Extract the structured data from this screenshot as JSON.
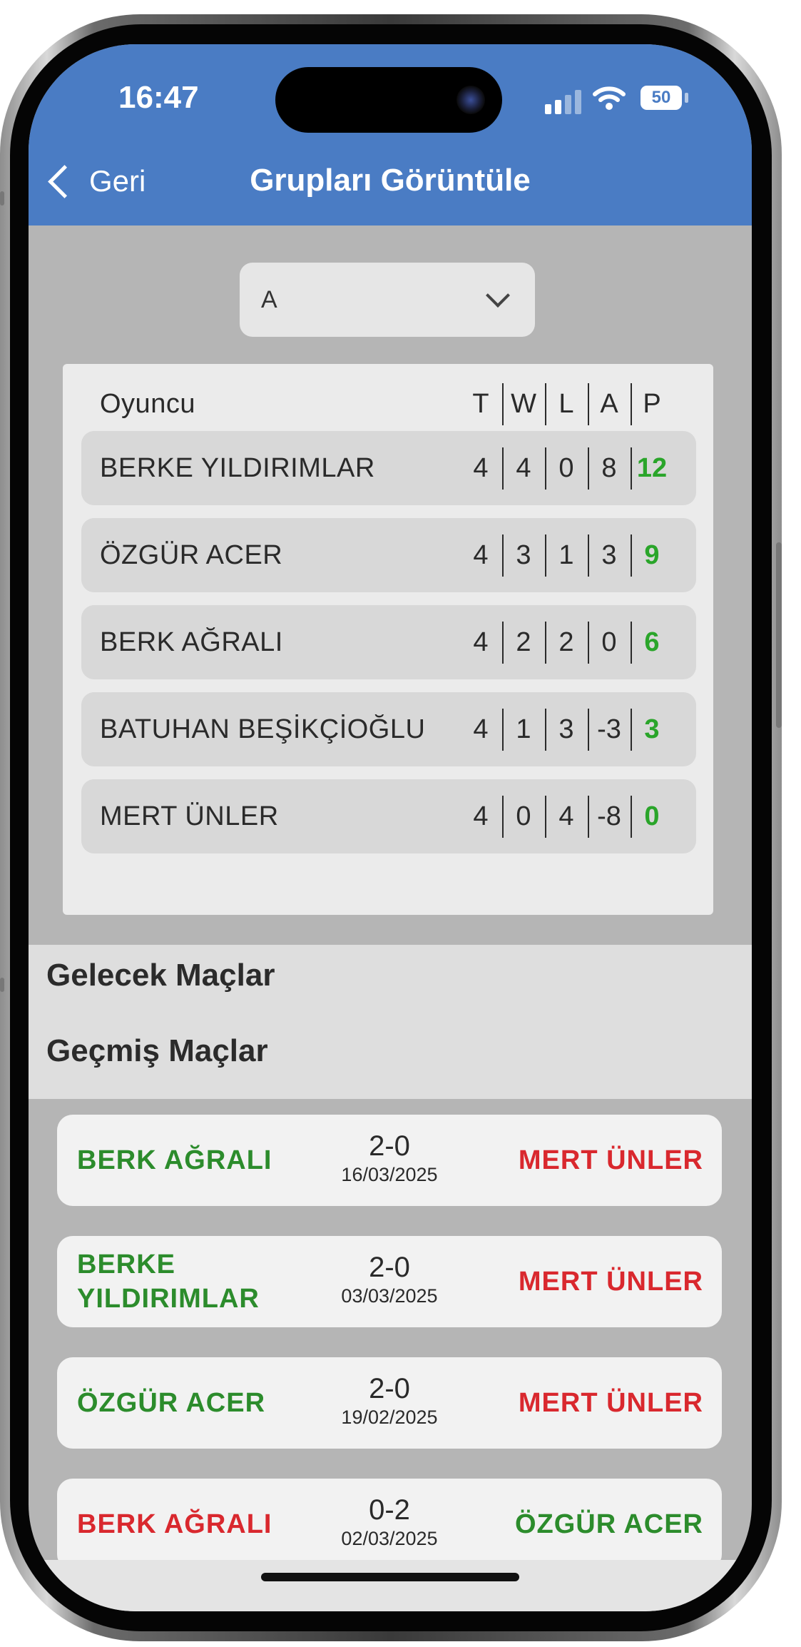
{
  "status_bar": {
    "time": "16:47",
    "battery": "50"
  },
  "nav": {
    "back_label": "Geri",
    "title": "Grupları Görüntüle"
  },
  "group_select": {
    "value": "A"
  },
  "standings": {
    "headers": {
      "player": "Oyuncu",
      "t": "T",
      "w": "W",
      "l": "L",
      "a": "A",
      "p": "P"
    },
    "rows": [
      {
        "player": "BERKE  YILDIRIMLAR",
        "t": "4",
        "w": "4",
        "l": "0",
        "a": "8",
        "p": "12"
      },
      {
        "player": "ÖZGÜR  ACER",
        "t": "4",
        "w": "3",
        "l": "1",
        "a": "3",
        "p": "9"
      },
      {
        "player": "BERK  AĞRALI",
        "t": "4",
        "w": "2",
        "l": "2",
        "a": "0",
        "p": "6"
      },
      {
        "player": "BATUHAN  BEŞİKÇİOĞLU",
        "t": "4",
        "w": "1",
        "l": "3",
        "a": "-3",
        "p": "3"
      },
      {
        "player": "MERT  ÜNLER",
        "t": "4",
        "w": "0",
        "l": "4",
        "a": "-8",
        "p": "0"
      }
    ]
  },
  "sections": {
    "upcoming": "Gelecek Maçlar",
    "past": "Geçmiş Maçlar"
  },
  "matches": [
    {
      "home": "BERK  AĞRALI",
      "score": "2-0",
      "date": "16/03/2025",
      "away": "MERT  ÜNLER"
    },
    {
      "home": "BERKE YILDIRIMLAR",
      "score": "2-0",
      "date": "03/03/2025",
      "away": "MERT  ÜNLER"
    },
    {
      "home": "ÖZGÜR  ACER",
      "score": "2-0",
      "date": "19/02/2025",
      "away": "MERT  ÜNLER"
    },
    {
      "home": "BERK  AĞRALI",
      "score": "0-2",
      "date": "02/03/2025",
      "away": "ÖZGÜR  ACER"
    }
  ],
  "colors": {
    "header": "#4a7cc4",
    "win": "#2c8c2c",
    "lose": "#d9282e",
    "points": "#2aa52a"
  }
}
